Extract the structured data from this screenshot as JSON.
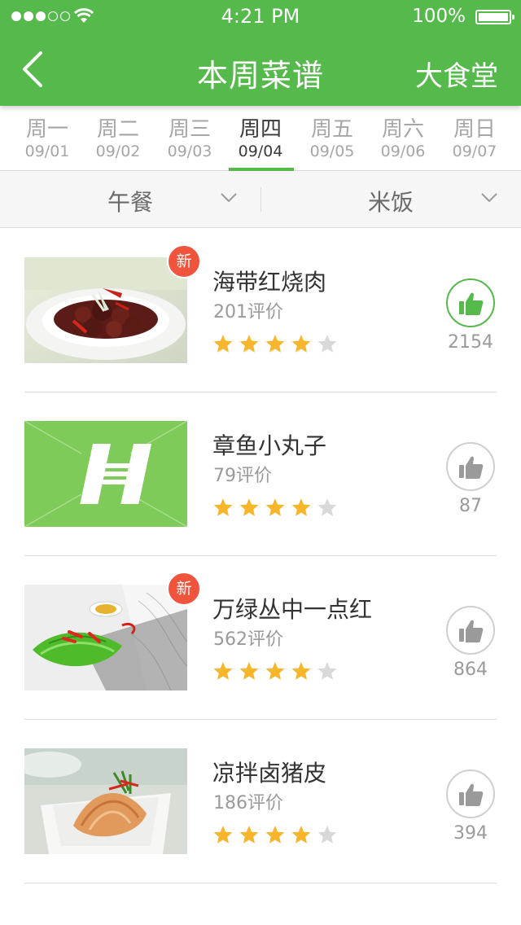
{
  "status_bar": {
    "time": "4:21 PM",
    "battery": "100%",
    "signal_bars_filled": 3,
    "signal_bars_total": 5
  },
  "nav": {
    "back_icon": "chevron-left-icon",
    "title": "本周菜谱",
    "right_label": "大食堂",
    "bar_color": "#55b94c"
  },
  "days": [
    {
      "name": "周一",
      "date": "09/01"
    },
    {
      "name": "周二",
      "date": "09/02"
    },
    {
      "name": "周三",
      "date": "09/03"
    },
    {
      "name": "周四",
      "date": "09/04"
    },
    {
      "name": "周五",
      "date": "09/05"
    },
    {
      "name": "周六",
      "date": "09/06"
    },
    {
      "name": "周日",
      "date": "09/07"
    }
  ],
  "selected_day_index": 3,
  "filters": {
    "meal": "午餐",
    "category": "米饭"
  },
  "dishes": [
    {
      "name": "海带红烧肉",
      "reviews": "201评价",
      "rating": 4,
      "rating_max": 5,
      "likes": "2154",
      "liked": true,
      "is_new": true,
      "new_label": "新",
      "image": "braised-pork-photo"
    },
    {
      "name": "章鱼小丸子",
      "reviews": "79评价",
      "rating": 4,
      "rating_max": 5,
      "likes": "87",
      "liked": false,
      "is_new": false,
      "new_label": "",
      "image": "placeholder-logo"
    },
    {
      "name": "万绿丛中一点红",
      "reviews": "562评价",
      "rating": 4,
      "rating_max": 5,
      "likes": "864",
      "liked": false,
      "is_new": true,
      "new_label": "新",
      "image": "snow-peas-photo"
    },
    {
      "name": "凉拌卤猪皮",
      "reviews": "186评价",
      "rating": 4,
      "rating_max": 5,
      "likes": "394",
      "liked": false,
      "is_new": false,
      "new_label": "",
      "image": "pork-skin-photo"
    }
  ],
  "colors": {
    "accent": "#55b94c",
    "badge": "#f0543c",
    "star_on": "#f7b52c",
    "star_off": "#d9d9d9"
  }
}
